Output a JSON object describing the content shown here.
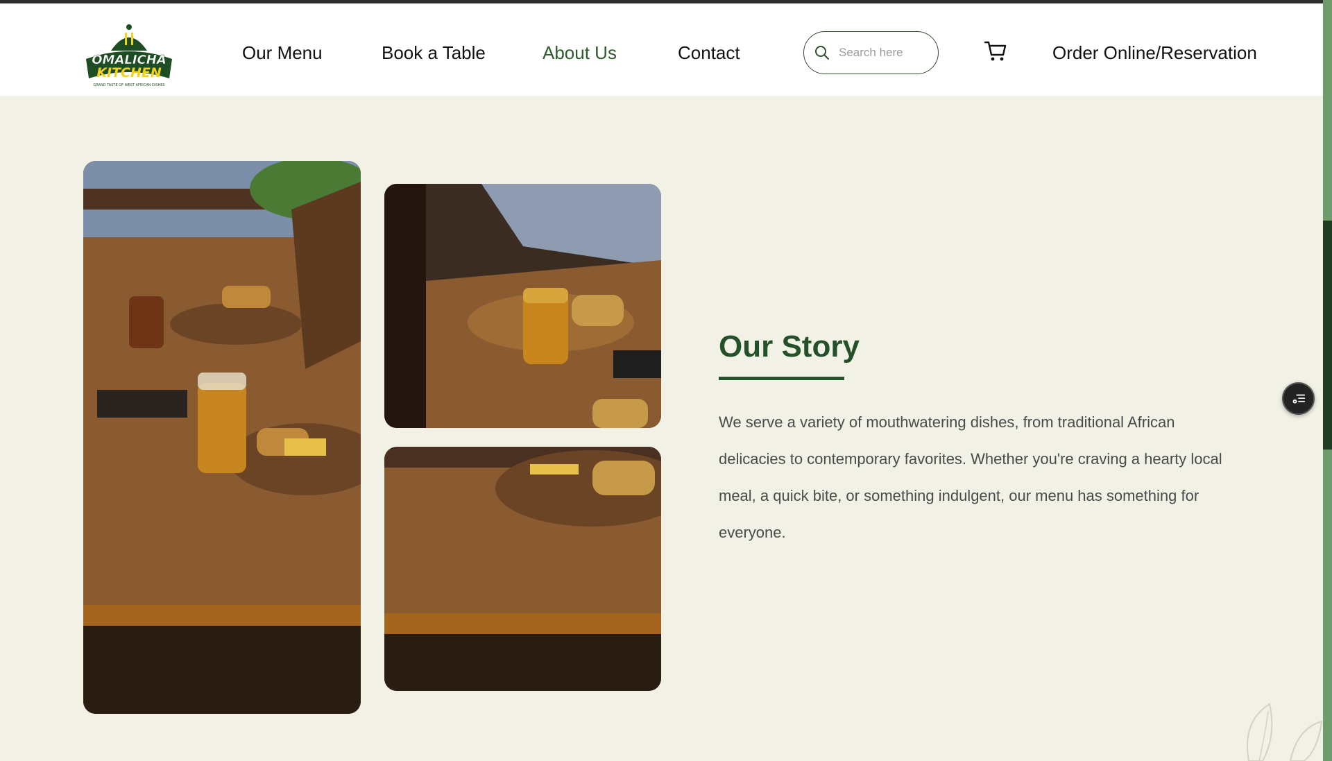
{
  "header": {
    "logo": {
      "text_line1": "OMALICHA",
      "text_line2": "KITCHEN",
      "tagline": "GRAND TASTE OF WEST AFRICAN DISHES"
    },
    "nav": [
      {
        "label": "Our Menu",
        "active": false
      },
      {
        "label": "Book a Table",
        "active": false
      },
      {
        "label": "About Us",
        "active": true
      },
      {
        "label": "Contact",
        "active": false
      }
    ],
    "search": {
      "placeholder": "Search here",
      "value": "",
      "icon": "search-icon"
    },
    "cart_icon": "cart-icon",
    "order_label": "Order Online/Reservation"
  },
  "story": {
    "title": "Our Story",
    "body": "We serve a variety of mouthwatering dishes, from traditional African delicacies to contemporary favorites. Whether you're craving a hearty local meal, a quick bite, or something indulgent, our menu has something for everyone."
  },
  "colors": {
    "brand_green": "#24502a",
    "page_bg": "#f2f1e5",
    "header_bg": "#ffffff",
    "logo_yellow": "#f2d21b"
  }
}
